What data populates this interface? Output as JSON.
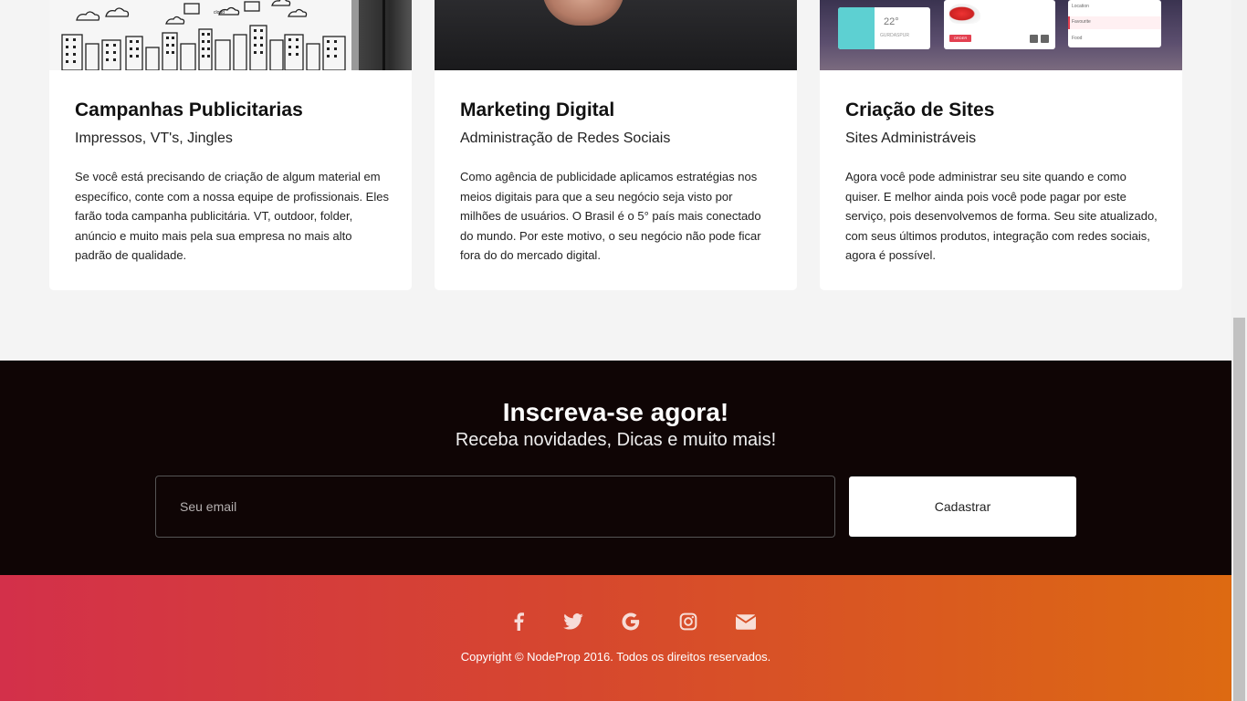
{
  "cards": [
    {
      "title": "Campanhas Publicitarias",
      "subtitle": "Impressos, VT's, Jingles",
      "text": "Se você está precisando de criação de algum material em específico, conte com a nossa equipe de profissionais. Eles farão toda campanha publicitária. VT, outdoor, folder, anúncio e muito mais pela sua empresa no mais alto padrão de qualidade.",
      "image_label": "cloud"
    },
    {
      "title": "Marketing Digital",
      "subtitle": "Administração de Redes Sociais",
      "text": "Como agência de publicidade aplicamos estratégias nos meios digitais para que a seu negócio seja visto por milhões de usuários. O Brasil é o 5° país mais conectado do mundo. Por este motivo, o seu negócio não pode ficar fora do do mercado digital."
    },
    {
      "title": "Criação de Sites",
      "subtitle": "Sites Administráveis",
      "text": "Agora você pode administrar seu site quando e como quiser. E melhor ainda pois você pode pagar por este serviço, pois desenvolvemos de forma. Seu site atualizado, com seus últimos produtos, integração com redes sociais, agora é possível.",
      "image_ui": {
        "temp": "22°",
        "city": "GURDASPUR",
        "order": "ORDER",
        "list": [
          "Location",
          "Favourite",
          "Food"
        ]
      }
    }
  ],
  "subscribe": {
    "title": "Inscreva-se agora!",
    "subtitle": "Receba novidades, Dicas e muito mais!",
    "email_placeholder": "Seu email",
    "button_label": "Cadastrar"
  },
  "footer": {
    "socials": [
      {
        "name": "facebook-icon",
        "glyph": "f"
      },
      {
        "name": "twitter-icon",
        "glyph": "🐦"
      },
      {
        "name": "google-icon",
        "glyph": "G"
      },
      {
        "name": "instagram-icon",
        "glyph": "◎"
      },
      {
        "name": "email-icon",
        "glyph": "✉"
      }
    ],
    "copyright": "Copyright © NodeProp 2016. Todos os direitos reservados."
  },
  "colors": {
    "subscribe_bg": "#0f0505",
    "footer_gradient_start": "#d3304a",
    "footer_gradient_end": "#dd6a12",
    "accent_cyan": "#5dd0d2",
    "accent_red": "#e34050"
  }
}
